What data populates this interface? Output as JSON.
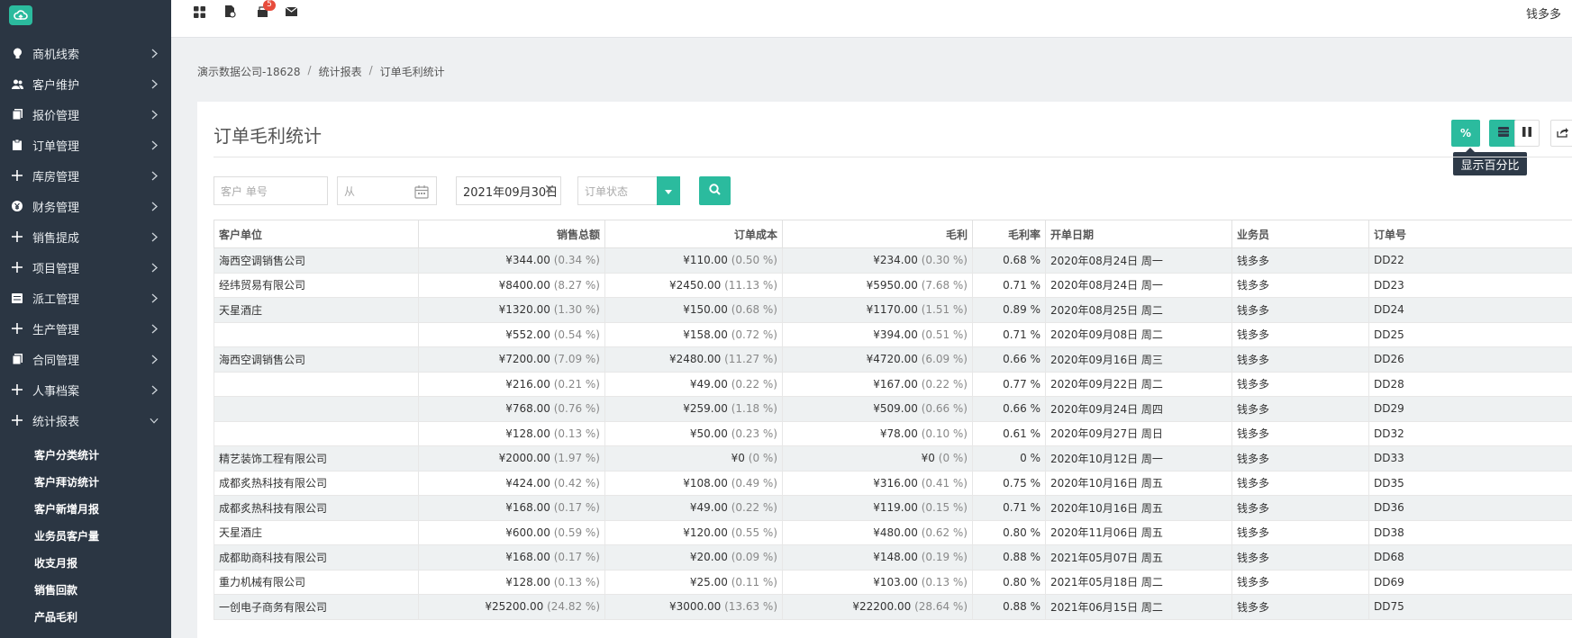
{
  "sidebar": {
    "menu": [
      {
        "label": "商机线索",
        "icon": "lightbulb-icon"
      },
      {
        "label": "客户维护",
        "icon": "users-icon"
      },
      {
        "label": "报价管理",
        "icon": "document-icon"
      },
      {
        "label": "订单管理",
        "icon": "clipboard-icon"
      },
      {
        "label": "库房管理",
        "icon": "plus-icon"
      },
      {
        "label": "财务管理",
        "icon": "yen-icon"
      },
      {
        "label": "销售提成",
        "icon": "plus-icon"
      },
      {
        "label": "项目管理",
        "icon": "plus-icon"
      },
      {
        "label": "派工管理",
        "icon": "list-icon"
      },
      {
        "label": "生产管理",
        "icon": "plus-icon"
      },
      {
        "label": "合同管理",
        "icon": "document-icon"
      },
      {
        "label": "人事档案",
        "icon": "plus-icon"
      },
      {
        "label": "统计报表",
        "icon": "plus-icon"
      }
    ],
    "submenu": [
      "客户分类统计",
      "客户拜访统计",
      "客户新增月报",
      "业务员客户量",
      "收支月报",
      "销售回款",
      "产品毛利"
    ]
  },
  "topbar": {
    "badge_count": "5",
    "user_name": "钱多多"
  },
  "breadcrumb": [
    "演示数据公司-18628",
    "统计报表",
    "订单毛利统计"
  ],
  "page_title": "订单毛利统计",
  "toolbar": {
    "percent_label": "%",
    "tooltip": "显示百分比"
  },
  "filters": {
    "customer_placeholder": "客户 单号",
    "from_placeholder": "从",
    "to_value": "2021年09月30日",
    "status_placeholder": "订单状态"
  },
  "table": {
    "headers": [
      "客户单位",
      "销售总额",
      "订单成本",
      "毛利",
      "毛利率",
      "开单日期",
      "业务员",
      "订单号"
    ],
    "rows": [
      {
        "customer": "海西空调销售公司",
        "sales": "¥344.00",
        "sales_pct": "(0.34 %)",
        "cost": "¥110.00",
        "cost_pct": "(0.50 %)",
        "profit": "¥234.00",
        "profit_pct": "(0.30 %)",
        "rate": "0.68 %",
        "date": "2020年08月24日 周一",
        "rep": "钱多多",
        "order": "DD22"
      },
      {
        "customer": "经纬贸易有限公司",
        "sales": "¥8400.00",
        "sales_pct": "(8.27 %)",
        "cost": "¥2450.00",
        "cost_pct": "(11.13 %)",
        "profit": "¥5950.00",
        "profit_pct": "(7.68 %)",
        "rate": "0.71 %",
        "date": "2020年08月24日 周一",
        "rep": "钱多多",
        "order": "DD23"
      },
      {
        "customer": "天星酒庄",
        "sales": "¥1320.00",
        "sales_pct": "(1.30 %)",
        "cost": "¥150.00",
        "cost_pct": "(0.68 %)",
        "profit": "¥1170.00",
        "profit_pct": "(1.51 %)",
        "rate": "0.89 %",
        "date": "2020年08月25日 周二",
        "rep": "钱多多",
        "order": "DD24"
      },
      {
        "customer": "",
        "sales": "¥552.00",
        "sales_pct": "(0.54 %)",
        "cost": "¥158.00",
        "cost_pct": "(0.72 %)",
        "profit": "¥394.00",
        "profit_pct": "(0.51 %)",
        "rate": "0.71 %",
        "date": "2020年09月08日 周二",
        "rep": "钱多多",
        "order": "DD25"
      },
      {
        "customer": "海西空调销售公司",
        "sales": "¥7200.00",
        "sales_pct": "(7.09 %)",
        "cost": "¥2480.00",
        "cost_pct": "(11.27 %)",
        "profit": "¥4720.00",
        "profit_pct": "(6.09 %)",
        "rate": "0.66 %",
        "date": "2020年09月16日 周三",
        "rep": "钱多多",
        "order": "DD26"
      },
      {
        "customer": "",
        "sales": "¥216.00",
        "sales_pct": "(0.21 %)",
        "cost": "¥49.00",
        "cost_pct": "(0.22 %)",
        "profit": "¥167.00",
        "profit_pct": "(0.22 %)",
        "rate": "0.77 %",
        "date": "2020年09月22日 周二",
        "rep": "钱多多",
        "order": "DD28"
      },
      {
        "customer": "",
        "sales": "¥768.00",
        "sales_pct": "(0.76 %)",
        "cost": "¥259.00",
        "cost_pct": "(1.18 %)",
        "profit": "¥509.00",
        "profit_pct": "(0.66 %)",
        "rate": "0.66 %",
        "date": "2020年09月24日 周四",
        "rep": "钱多多",
        "order": "DD29"
      },
      {
        "customer": "",
        "sales": "¥128.00",
        "sales_pct": "(0.13 %)",
        "cost": "¥50.00",
        "cost_pct": "(0.23 %)",
        "profit": "¥78.00",
        "profit_pct": "(0.10 %)",
        "rate": "0.61 %",
        "date": "2020年09月27日 周日",
        "rep": "钱多多",
        "order": "DD32"
      },
      {
        "customer": "精艺装饰工程有限公司",
        "sales": "¥2000.00",
        "sales_pct": "(1.97 %)",
        "cost": "¥0",
        "cost_pct": "(0 %)",
        "profit": "¥0",
        "profit_pct": "(0 %)",
        "rate": "0 %",
        "date": "2020年10月12日 周一",
        "rep": "钱多多",
        "order": "DD33"
      },
      {
        "customer": "成都炙热科技有限公司",
        "sales": "¥424.00",
        "sales_pct": "(0.42 %)",
        "cost": "¥108.00",
        "cost_pct": "(0.49 %)",
        "profit": "¥316.00",
        "profit_pct": "(0.41 %)",
        "rate": "0.75 %",
        "date": "2020年10月16日 周五",
        "rep": "钱多多",
        "order": "DD35"
      },
      {
        "customer": "成都炙热科技有限公司",
        "sales": "¥168.00",
        "sales_pct": "(0.17 %)",
        "cost": "¥49.00",
        "cost_pct": "(0.22 %)",
        "profit": "¥119.00",
        "profit_pct": "(0.15 %)",
        "rate": "0.71 %",
        "date": "2020年10月16日 周五",
        "rep": "钱多多",
        "order": "DD36"
      },
      {
        "customer": "天星酒庄",
        "sales": "¥600.00",
        "sales_pct": "(0.59 %)",
        "cost": "¥120.00",
        "cost_pct": "(0.55 %)",
        "profit": "¥480.00",
        "profit_pct": "(0.62 %)",
        "rate": "0.80 %",
        "date": "2020年11月06日 周五",
        "rep": "钱多多",
        "order": "DD38"
      },
      {
        "customer": "成都助商科技有限公司",
        "sales": "¥168.00",
        "sales_pct": "(0.17 %)",
        "cost": "¥20.00",
        "cost_pct": "(0.09 %)",
        "profit": "¥148.00",
        "profit_pct": "(0.19 %)",
        "rate": "0.88 %",
        "date": "2021年05月07日 周五",
        "rep": "钱多多",
        "order": "DD68"
      },
      {
        "customer": "重力机械有限公司",
        "sales": "¥128.00",
        "sales_pct": "(0.13 %)",
        "cost": "¥25.00",
        "cost_pct": "(0.11 %)",
        "profit": "¥103.00",
        "profit_pct": "(0.13 %)",
        "rate": "0.80 %",
        "date": "2021年05月18日 周二",
        "rep": "钱多多",
        "order": "DD69"
      },
      {
        "customer": "一创电子商务有限公司",
        "sales": "¥25200.00",
        "sales_pct": "(24.82 %)",
        "cost": "¥3000.00",
        "cost_pct": "(13.63 %)",
        "profit": "¥22200.00",
        "profit_pct": "(28.64 %)",
        "rate": "0.88 %",
        "date": "2021年06月15日 周二",
        "rep": "钱多多",
        "order": "DD75"
      }
    ]
  }
}
